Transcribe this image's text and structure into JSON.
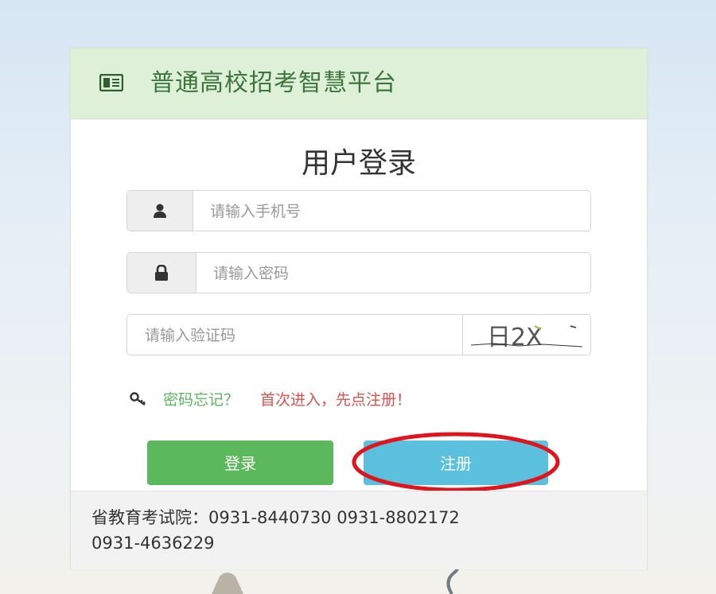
{
  "header": {
    "title": "普通高校招考智慧平台",
    "icon": "id-card-icon"
  },
  "login": {
    "title": "用户登录",
    "phone_placeholder": "请输入手机号",
    "password_placeholder": "请输入密码",
    "captcha_placeholder": "请输入验证码",
    "captcha_image_text": "日2X",
    "forgot_password": "密码忘记？",
    "first_visit_hint": "首次进入，先点注册！",
    "login_button": "登录",
    "register_button": "注册"
  },
  "footer": {
    "line1": "省教育考试院：0931-8440730  0931-8802172",
    "line2": "0931-4636229"
  },
  "colors": {
    "header_bg": "#dff0d8",
    "header_text": "#3c763d",
    "login_button": "#5cb85c",
    "register_button": "#5bc0de",
    "forgot_link": "#5cb85c",
    "hint_text": "#d9534f",
    "highlight_ellipse": "#e0141c"
  }
}
